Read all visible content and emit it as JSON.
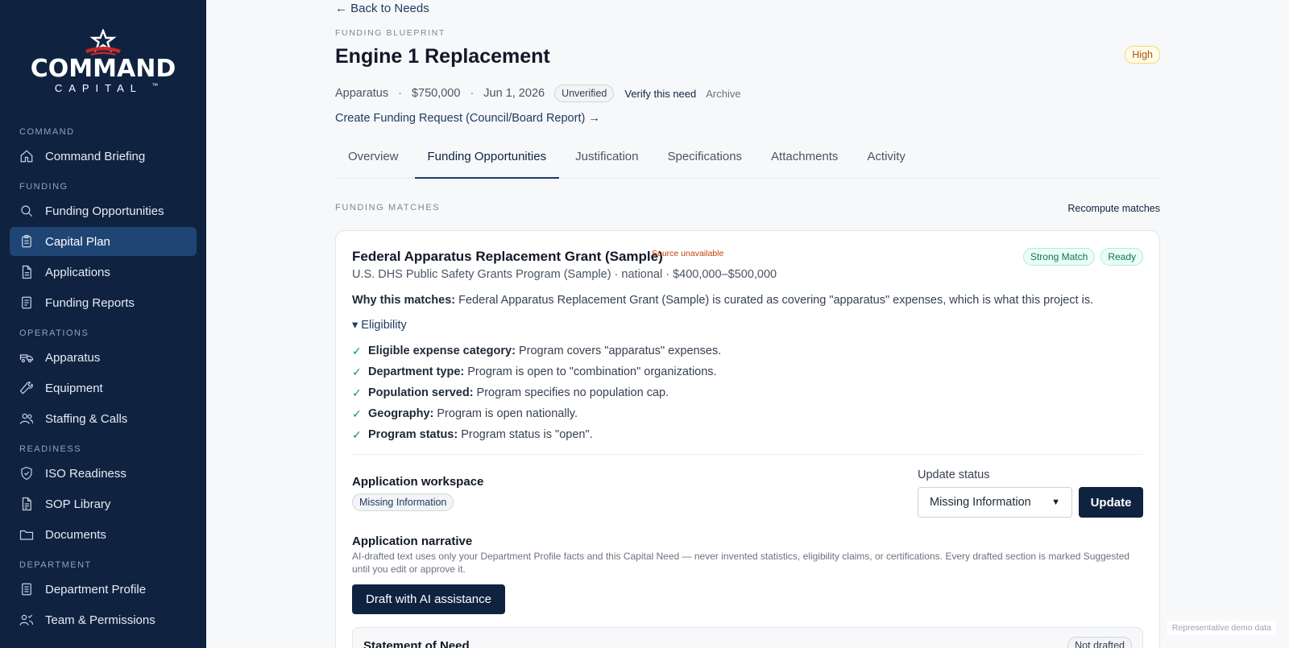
{
  "brand": {
    "name": "COMMAND",
    "sub": "CAPITAL",
    "tm": "™"
  },
  "sidebar": {
    "sections": [
      {
        "label": "COMMAND",
        "items": [
          {
            "label": "Command Briefing",
            "icon": "home-icon"
          }
        ]
      },
      {
        "label": "FUNDING",
        "items": [
          {
            "label": "Funding Opportunities",
            "icon": "search-icon"
          },
          {
            "label": "Capital Plan",
            "icon": "clipboard-icon",
            "active": true
          },
          {
            "label": "Applications",
            "icon": "document-icon"
          },
          {
            "label": "Funding Reports",
            "icon": "report-icon"
          }
        ]
      },
      {
        "label": "OPERATIONS",
        "items": [
          {
            "label": "Apparatus",
            "icon": "truck-icon"
          },
          {
            "label": "Equipment",
            "icon": "wrench-icon"
          },
          {
            "label": "Staffing & Calls",
            "icon": "users-icon"
          }
        ]
      },
      {
        "label": "READINESS",
        "items": [
          {
            "label": "ISO Readiness",
            "icon": "shield-check-icon"
          },
          {
            "label": "SOP Library",
            "icon": "book-icon"
          },
          {
            "label": "Documents",
            "icon": "folder-icon"
          }
        ]
      },
      {
        "label": "DEPARTMENT",
        "items": [
          {
            "label": "Department Profile",
            "icon": "profile-doc-icon"
          },
          {
            "label": "Team & Permissions",
            "icon": "team-icon"
          }
        ]
      }
    ]
  },
  "header": {
    "back": "← Back to Needs",
    "eyebrow": "FUNDING BLUEPRINT",
    "title": "Engine 1 Replacement",
    "priority": "High",
    "meta": {
      "category": "Apparatus",
      "amount": "$750,000",
      "date": "Jun 1, 2026",
      "status": "Unverified",
      "verify": "Verify this need",
      "archive": "Archive"
    },
    "create_link": "Create Funding Request (Council/Board Report) →"
  },
  "tabs": [
    "Overview",
    "Funding Opportunities",
    "Justification",
    "Specifications",
    "Attachments",
    "Activity"
  ],
  "active_tab": 1,
  "matches": {
    "label": "FUNDING MATCHES",
    "recompute": "Recompute matches",
    "card": {
      "title": "Federal Apparatus Replacement Grant (Sample)",
      "source_flag": "Source unavailable",
      "badges": [
        "Strong Match",
        "Ready"
      ],
      "subtitle": "U.S. DHS Public Safety Grants Program (Sample) · national · $400,000–$500,000",
      "why_label": "Why this matches:",
      "why_text": " Federal Apparatus Replacement Grant (Sample) is curated as covering \"apparatus\" expenses, which is what this project is.",
      "eligibility_toggle": "▾ Eligibility",
      "eligibility": [
        {
          "label": "Eligible expense category:",
          "text": "Program covers \"apparatus\" expenses."
        },
        {
          "label": "Department type:",
          "text": "Program is open to \"combination\" organizations."
        },
        {
          "label": "Population served:",
          "text": "Program specifies no population cap."
        },
        {
          "label": "Geography:",
          "text": "Program is open nationally."
        },
        {
          "label": "Program status:",
          "text": "Program status is \"open\"."
        }
      ],
      "workspace": {
        "title": "Application workspace",
        "status": "Missing Information"
      },
      "update_status": {
        "label": "Update status",
        "selected": "Missing Information",
        "button": "Update"
      },
      "narrative": {
        "title": "Application narrative",
        "desc": "AI-drafted text uses only your Department Profile facts and this Capital Need — never invented statistics, eligibility claims, or certifications. Every drafted section is marked Suggested until you edit or approve it.",
        "button": "Draft with AI assistance"
      },
      "section": {
        "title": "Statement of Need",
        "status": "Not drafted"
      }
    }
  },
  "demo_note": "Representative demo data"
}
